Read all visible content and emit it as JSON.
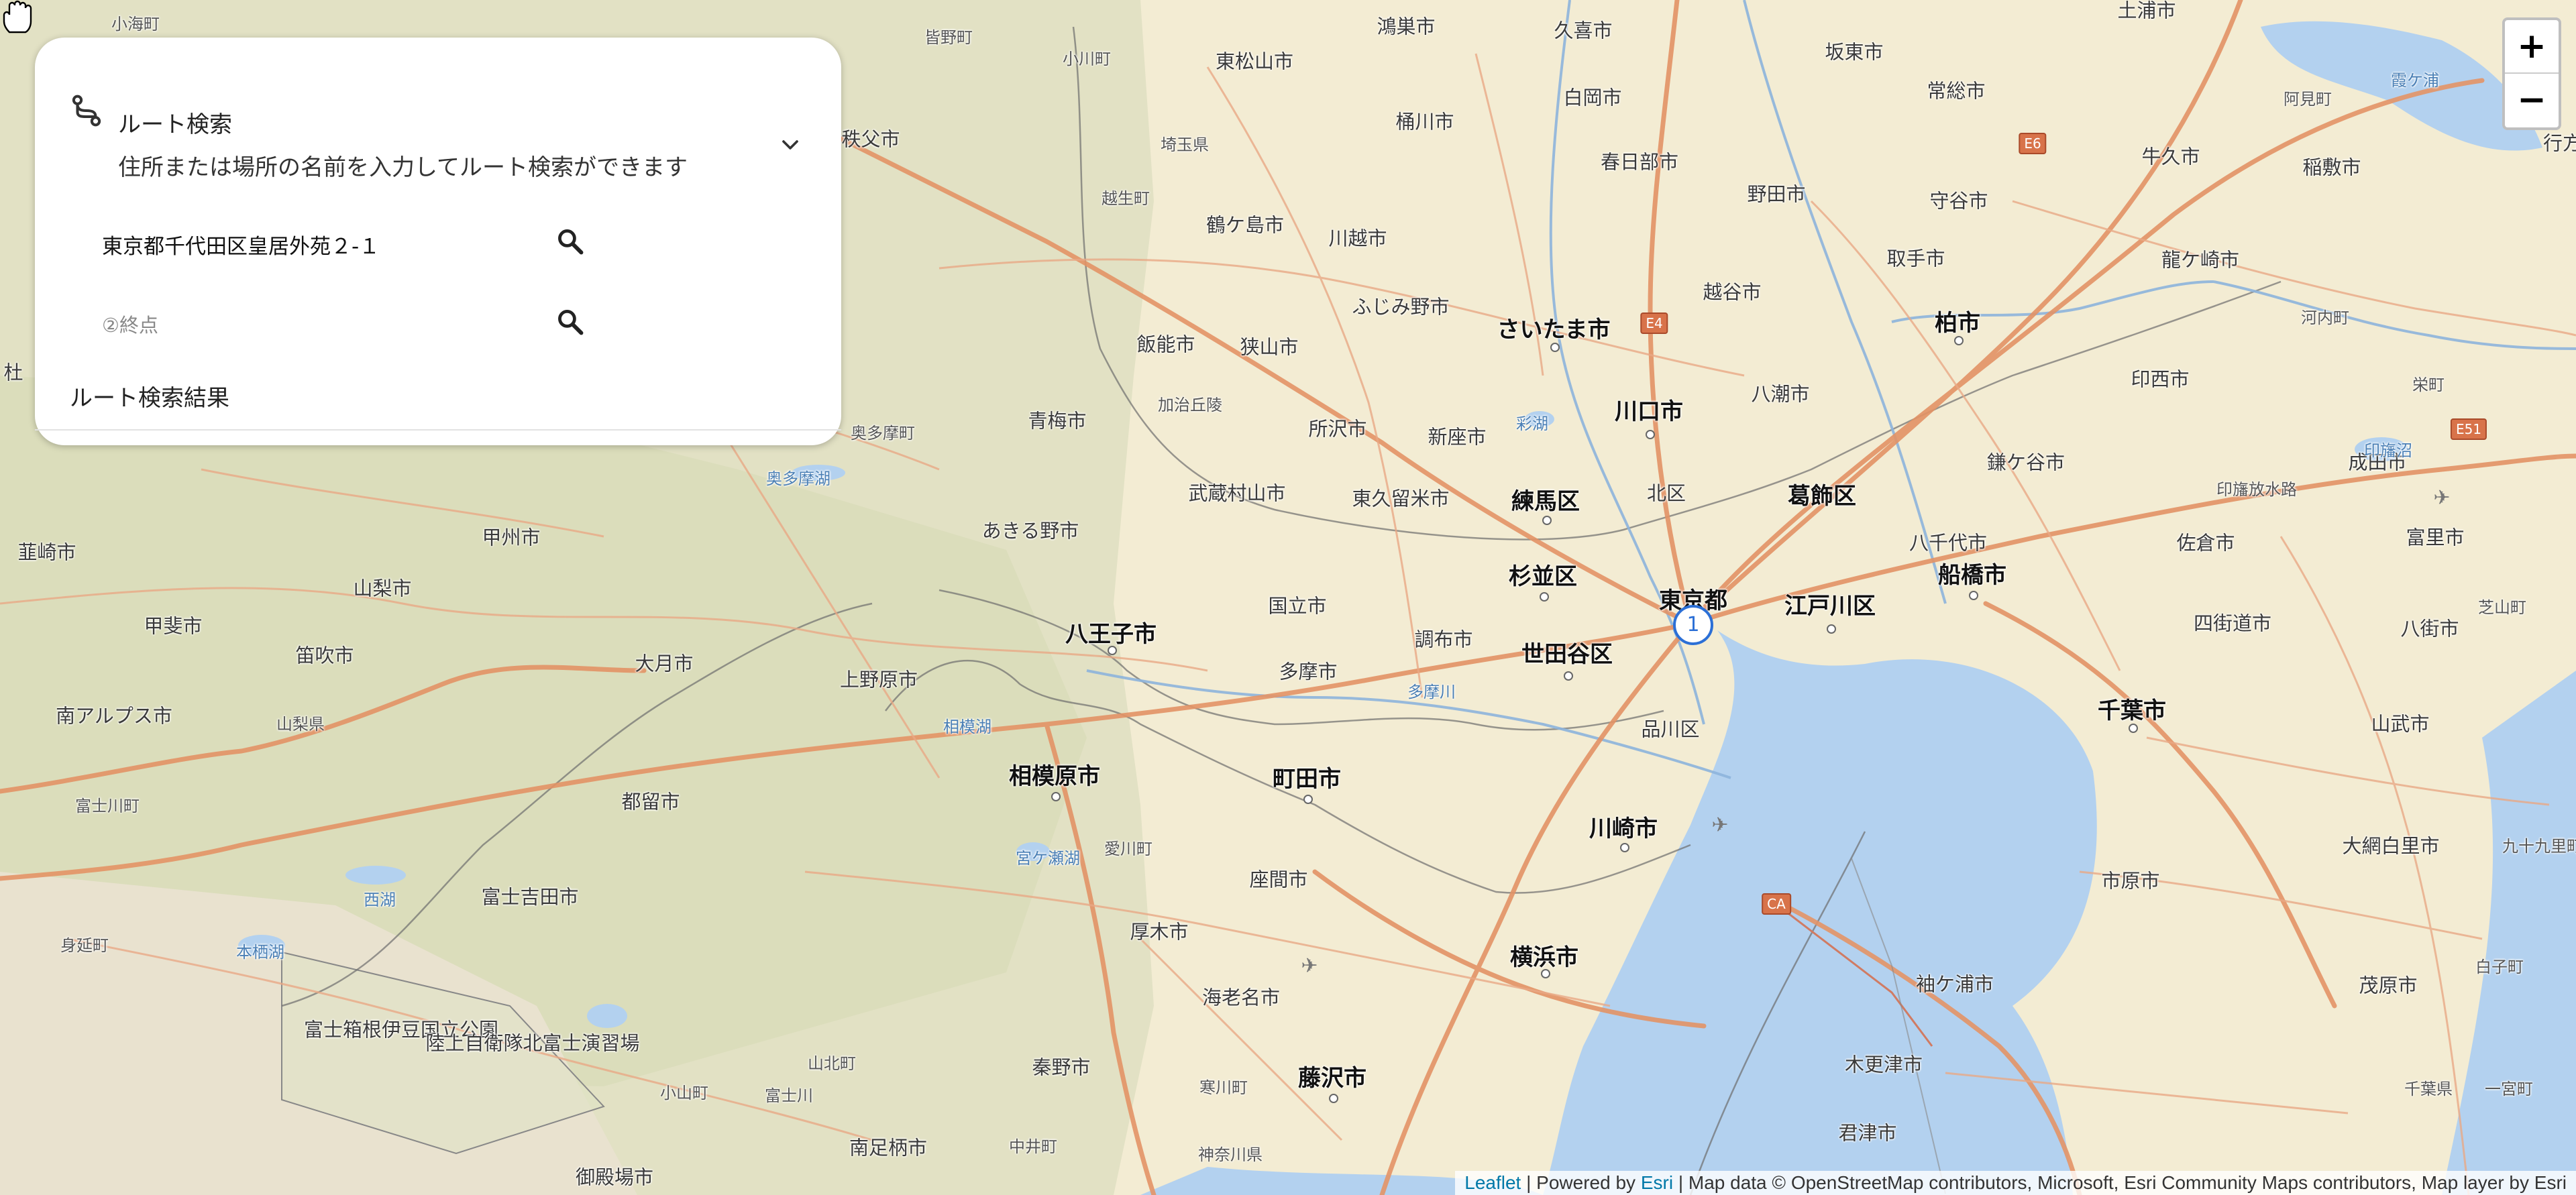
{
  "route_panel": {
    "title": "ルート検索",
    "subtitle": "住所または場所の名前を入力してルート検索ができます",
    "start_value": "東京都千代田区皇居外苑２-１",
    "end_placeholder": "②終点",
    "results_label": "ルート検索結果"
  },
  "zoom": {
    "in_label": "+",
    "out_label": "−"
  },
  "marker": {
    "label": "1"
  },
  "attribution": {
    "leaflet": "Leaflet",
    "sep1": " | Powered by ",
    "esri": "Esri",
    "rest": " | Map data © OpenStreetMap contributors, Microsoft, Esri Community Maps contributors, Map layer by Esri"
  },
  "map": {
    "shields": [
      {
        "id": "e4",
        "label": "E4"
      },
      {
        "id": "e6",
        "label": "E6"
      },
      {
        "id": "e51",
        "label": "E51"
      },
      {
        "id": "ca",
        "label": "CA"
      }
    ],
    "places": [
      {
        "id": "p1",
        "name": "鴻巣市",
        "cls": ""
      },
      {
        "id": "p2",
        "name": "久喜市",
        "cls": ""
      },
      {
        "id": "p3",
        "name": "坂東市",
        "cls": ""
      },
      {
        "id": "p4",
        "name": "東松山市",
        "cls": ""
      },
      {
        "id": "p5",
        "name": "白岡市",
        "cls": ""
      },
      {
        "id": "p6",
        "name": "常総市",
        "cls": ""
      },
      {
        "id": "p7",
        "name": "土浦市",
        "cls": ""
      },
      {
        "id": "p8",
        "name": "霞ケ浦",
        "cls": "water"
      },
      {
        "id": "p9",
        "name": "桶川市",
        "cls": ""
      },
      {
        "id": "p10",
        "name": "春日部市",
        "cls": ""
      },
      {
        "id": "p11",
        "name": "守谷市",
        "cls": ""
      },
      {
        "id": "p12",
        "name": "牛久市",
        "cls": ""
      },
      {
        "id": "p13",
        "name": "稲敷市",
        "cls": ""
      },
      {
        "id": "p14",
        "name": "鶴ケ島市",
        "cls": ""
      },
      {
        "id": "p15",
        "name": "川越市",
        "cls": ""
      },
      {
        "id": "p16",
        "name": "野田市",
        "cls": ""
      },
      {
        "id": "p17",
        "name": "取手市",
        "cls": ""
      },
      {
        "id": "p18",
        "name": "龍ケ崎市",
        "cls": ""
      },
      {
        "id": "p19",
        "name": "ふじみ野市",
        "cls": ""
      },
      {
        "id": "p20",
        "name": "越谷市",
        "cls": ""
      },
      {
        "id": "p21",
        "name": "飯能市",
        "cls": ""
      },
      {
        "id": "p22",
        "name": "狭山市",
        "cls": ""
      },
      {
        "id": "p23",
        "name": "さいたま市",
        "cls": "major"
      },
      {
        "id": "p24",
        "name": "柏市",
        "cls": "major"
      },
      {
        "id": "p25",
        "name": "河内町",
        "cls": "minor"
      },
      {
        "id": "p26",
        "name": "青梅市",
        "cls": ""
      },
      {
        "id": "p27",
        "name": "川口市",
        "cls": "major"
      },
      {
        "id": "p28",
        "name": "八潮市",
        "cls": ""
      },
      {
        "id": "p29",
        "name": "印西市",
        "cls": ""
      },
      {
        "id": "p30",
        "name": "所沢市",
        "cls": ""
      },
      {
        "id": "p31",
        "name": "新座市",
        "cls": ""
      },
      {
        "id": "p32",
        "name": "鎌ケ谷市",
        "cls": ""
      },
      {
        "id": "p33",
        "name": "成田市",
        "cls": ""
      },
      {
        "id": "p34",
        "name": "武蔵村山市",
        "cls": ""
      },
      {
        "id": "p35",
        "name": "東久留米市",
        "cls": ""
      },
      {
        "id": "p36",
        "name": "練馬区",
        "cls": "major"
      },
      {
        "id": "p37",
        "name": "北区",
        "cls": ""
      },
      {
        "id": "p38",
        "name": "葛飾区",
        "cls": "major"
      },
      {
        "id": "p39",
        "name": "甲州市",
        "cls": ""
      },
      {
        "id": "p40",
        "name": "あきる野市",
        "cls": ""
      },
      {
        "id": "p41",
        "name": "八千代市",
        "cls": ""
      },
      {
        "id": "p42",
        "name": "佐倉市",
        "cls": ""
      },
      {
        "id": "p43",
        "name": "富里市",
        "cls": ""
      },
      {
        "id": "p44",
        "name": "韮崎市",
        "cls": ""
      },
      {
        "id": "p45",
        "name": "山梨市",
        "cls": ""
      },
      {
        "id": "p46",
        "name": "杉並区",
        "cls": "major"
      },
      {
        "id": "p47",
        "name": "東京都",
        "cls": "major"
      },
      {
        "id": "p48",
        "name": "船橋市",
        "cls": "major"
      },
      {
        "id": "p49",
        "name": "国立市",
        "cls": ""
      },
      {
        "id": "p50",
        "name": "江戸川区",
        "cls": "major"
      },
      {
        "id": "p51",
        "name": "甲斐市",
        "cls": ""
      },
      {
        "id": "p52",
        "name": "八王子市",
        "cls": "major"
      },
      {
        "id": "p53",
        "name": "四街道市",
        "cls": ""
      },
      {
        "id": "p54",
        "name": "八街市",
        "cls": ""
      },
      {
        "id": "p55",
        "name": "笛吹市",
        "cls": ""
      },
      {
        "id": "p56",
        "name": "調布市",
        "cls": ""
      },
      {
        "id": "p57",
        "name": "世田谷区",
        "cls": "major"
      },
      {
        "id": "p58",
        "name": "大月市",
        "cls": ""
      },
      {
        "id": "p59",
        "name": "上野原市",
        "cls": ""
      },
      {
        "id": "p60",
        "name": "多摩市",
        "cls": ""
      },
      {
        "id": "p61",
        "name": "南アルプス市",
        "cls": ""
      },
      {
        "id": "p62",
        "name": "品川区",
        "cls": ""
      },
      {
        "id": "p63",
        "name": "千葉市",
        "cls": "major"
      },
      {
        "id": "p64",
        "name": "山武市",
        "cls": ""
      },
      {
        "id": "p65",
        "name": "相模原市",
        "cls": "major"
      },
      {
        "id": "p66",
        "name": "町田市",
        "cls": "major"
      },
      {
        "id": "p67",
        "name": "富士川町",
        "cls": "minor"
      },
      {
        "id": "p68",
        "name": "都留市",
        "cls": ""
      },
      {
        "id": "p69",
        "name": "川崎市",
        "cls": "major"
      },
      {
        "id": "p70",
        "name": "大網白里市",
        "cls": ""
      },
      {
        "id": "p71",
        "name": "宮ケ瀬湖",
        "cls": "water"
      },
      {
        "id": "p72",
        "name": "座間市",
        "cls": ""
      },
      {
        "id": "p73",
        "name": "市原市",
        "cls": ""
      },
      {
        "id": "p74",
        "name": "富士吉田市",
        "cls": ""
      },
      {
        "id": "p75",
        "name": "西湖",
        "cls": "water"
      },
      {
        "id": "p76",
        "name": "厚木市",
        "cls": ""
      },
      {
        "id": "p77",
        "name": "本栖湖",
        "cls": "water"
      },
      {
        "id": "p78",
        "name": "横浜市",
        "cls": "major"
      },
      {
        "id": "p79",
        "name": "身延町",
        "cls": "minor"
      },
      {
        "id": "p80",
        "name": "海老名市",
        "cls": ""
      },
      {
        "id": "p81",
        "name": "袖ケ浦市",
        "cls": ""
      },
      {
        "id": "p82",
        "name": "茂原市",
        "cls": ""
      },
      {
        "id": "p83",
        "name": "富士箱根伊豆国立公園",
        "cls": ""
      },
      {
        "id": "p84",
        "name": "陸上自衛隊北富士演習場",
        "cls": ""
      },
      {
        "id": "p85",
        "name": "秦野市",
        "cls": ""
      },
      {
        "id": "p86",
        "name": "木更津市",
        "cls": ""
      },
      {
        "id": "p87",
        "name": "藤沢市",
        "cls": "major"
      },
      {
        "id": "p88",
        "name": "山北町",
        "cls": "minor"
      },
      {
        "id": "p89",
        "name": "小山町",
        "cls": "minor"
      },
      {
        "id": "p90",
        "name": "南足柄市",
        "cls": ""
      },
      {
        "id": "p91",
        "name": "君津市",
        "cls": ""
      },
      {
        "id": "p92",
        "name": "御殿場市",
        "cls": ""
      },
      {
        "id": "p93",
        "name": "秩父市",
        "cls": ""
      },
      {
        "id": "p94",
        "name": "奥多摩町",
        "cls": "minor"
      },
      {
        "id": "p95",
        "name": "奥多摩湖",
        "cls": "water"
      },
      {
        "id": "p96",
        "name": "相模湖",
        "cls": "water"
      },
      {
        "id": "p97",
        "name": "多摩川",
        "cls": "water"
      },
      {
        "id": "p98",
        "name": "印旛沼",
        "cls": "water"
      },
      {
        "id": "p99",
        "name": "印旛放水路",
        "cls": "minor"
      },
      {
        "id": "p100",
        "name": "栄町",
        "cls": "minor"
      },
      {
        "id": "p101",
        "name": "芝山町",
        "cls": "minor"
      },
      {
        "id": "p102",
        "name": "九十九里町",
        "cls": "minor"
      },
      {
        "id": "p103",
        "name": "白子町",
        "cls": "minor"
      },
      {
        "id": "p104",
        "name": "一宮町",
        "cls": "minor"
      },
      {
        "id": "p105",
        "name": "千葉県",
        "cls": "minor"
      },
      {
        "id": "p106",
        "name": "神奈川県",
        "cls": "minor"
      },
      {
        "id": "p107",
        "name": "埼玉県",
        "cls": "minor"
      },
      {
        "id": "p108",
        "name": "山梨県",
        "cls": "minor"
      },
      {
        "id": "p109",
        "name": "富士川",
        "cls": "minor"
      },
      {
        "id": "p110",
        "name": "中井町",
        "cls": "minor"
      },
      {
        "id": "p111",
        "name": "寒川町",
        "cls": "minor"
      },
      {
        "id": "p112",
        "name": "愛川町",
        "cls": "minor"
      },
      {
        "id": "p113",
        "name": "阿見町",
        "cls": "minor"
      },
      {
        "id": "p114",
        "name": "越生町",
        "cls": "minor"
      },
      {
        "id": "p115",
        "name": "加治丘陵",
        "cls": "minor"
      },
      {
        "id": "p116",
        "name": "彩湖",
        "cls": "water"
      },
      {
        "id": "p117",
        "name": "小海町",
        "cls": "minor"
      },
      {
        "id": "p118",
        "name": "皆野町",
        "cls": "minor"
      },
      {
        "id": "p119",
        "name": "小川町",
        "cls": "minor"
      },
      {
        "id": "p120",
        "name": "行方",
        "cls": ""
      },
      {
        "id": "p121",
        "name": "杜",
        "cls": ""
      }
    ]
  }
}
